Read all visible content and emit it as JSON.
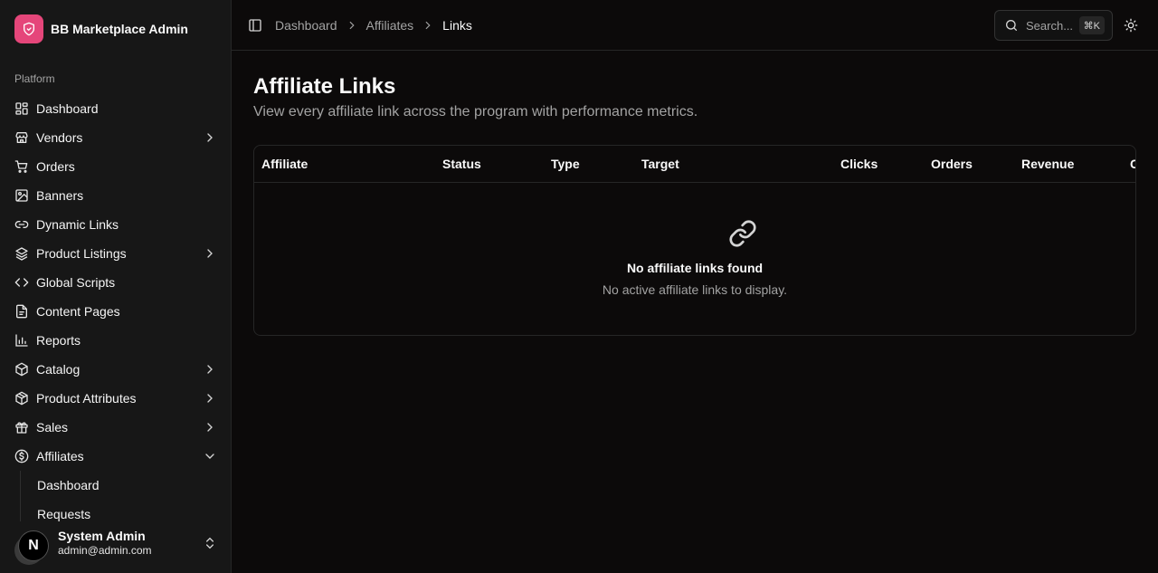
{
  "app": {
    "name": "BB Marketplace Admin",
    "logo_icon": "shield-icon",
    "accent": "#e5467a"
  },
  "sidebar": {
    "group_label": "Platform",
    "items": [
      {
        "label": "Dashboard",
        "icon": "dashboard-icon",
        "expandable": false
      },
      {
        "label": "Vendors",
        "icon": "store-icon",
        "expandable": true
      },
      {
        "label": "Orders",
        "icon": "cart-icon",
        "expandable": false
      },
      {
        "label": "Banners",
        "icon": "image-icon",
        "expandable": false
      },
      {
        "label": "Dynamic Links",
        "icon": "link-icon",
        "expandable": false
      },
      {
        "label": "Product Listings",
        "icon": "layers-icon",
        "expandable": true
      },
      {
        "label": "Global Scripts",
        "icon": "code-icon",
        "expandable": false
      },
      {
        "label": "Content Pages",
        "icon": "document-icon",
        "expandable": false
      },
      {
        "label": "Reports",
        "icon": "bar-chart-icon",
        "expandable": false
      },
      {
        "label": "Catalog",
        "icon": "package-icon",
        "expandable": true
      },
      {
        "label": "Product Attributes",
        "icon": "box-icon",
        "expandable": true
      },
      {
        "label": "Sales",
        "icon": "gift-icon",
        "expandable": true
      },
      {
        "label": "Affiliates",
        "icon": "dollar-circle-icon",
        "expandable": true,
        "expanded": true
      }
    ],
    "affiliates_sub": [
      "Dashboard",
      "Requests"
    ]
  },
  "user": {
    "avatar_letter": "N",
    "name": "System Admin",
    "email": "admin@admin.com"
  },
  "header": {
    "breadcrumb": [
      "Dashboard",
      "Affiliates",
      "Links"
    ],
    "search_placeholder": "Search...",
    "search_shortcut": "⌘K"
  },
  "main": {
    "title": "Affiliate Links",
    "subtitle": "View every affiliate link across the program with performance metrics.",
    "columns": [
      "Affiliate",
      "Status",
      "Type",
      "Target",
      "Clicks",
      "Orders",
      "Revenue",
      "C"
    ],
    "empty_title": "No affiliate links found",
    "empty_description": "No active affiliate links to display."
  }
}
